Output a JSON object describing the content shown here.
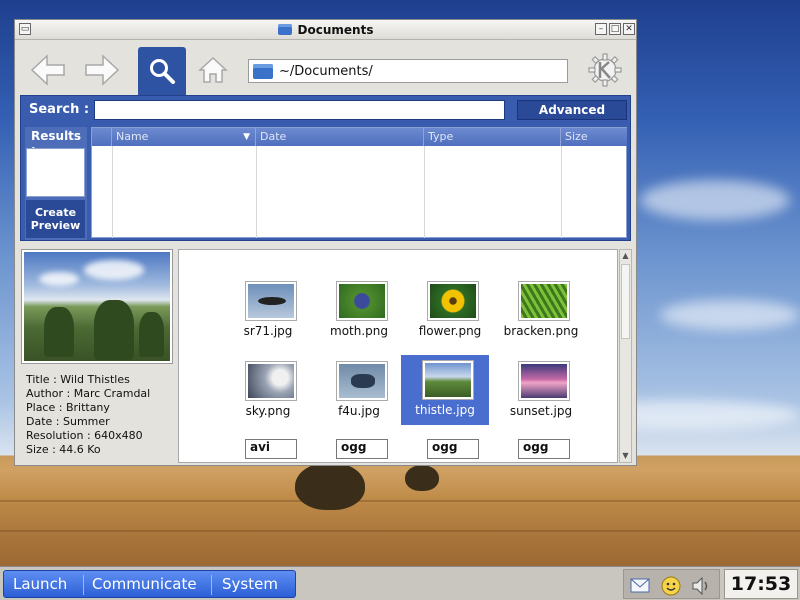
{
  "window": {
    "title": "Documents",
    "path": "~/Documents/"
  },
  "search": {
    "label": "Search :",
    "value": "",
    "advanced_label": "Advanced",
    "results_label": "Results :",
    "create_preview_label": "Create Preview",
    "columns": [
      "Name",
      "Date",
      "Type",
      "Size"
    ]
  },
  "preview": {
    "metadata": [
      "Title : Wild Thistles",
      "Author : Marc Cramdal",
      "Place : Brittany",
      "Date : Summer",
      "Resolution : 640x480",
      "Size : 44.6 Ko"
    ]
  },
  "files": [
    {
      "name": "sr71.jpg",
      "thumb": "jet-photo",
      "selected": false
    },
    {
      "name": "moth.png",
      "thumb": "moth-photo",
      "selected": false
    },
    {
      "name": "flower.png",
      "thumb": "flower-photo",
      "selected": false
    },
    {
      "name": "bracken.png",
      "thumb": "fern-photo",
      "selected": false
    },
    {
      "name": "sky.png",
      "thumb": "sky-photo",
      "selected": false
    },
    {
      "name": "f4u.jpg",
      "thumb": "plane-photo",
      "selected": false
    },
    {
      "name": "thistle.jpg",
      "thumb": "thistle-photo",
      "selected": true
    },
    {
      "name": "sunset.jpg",
      "thumb": "sunset-photo",
      "selected": false
    }
  ],
  "media_files": [
    "avi",
    "ogg",
    "ogg",
    "ogg"
  ],
  "taskbar": {
    "menus": [
      "Launch",
      "Communicate",
      "System"
    ],
    "tray_icons": [
      "mail-icon",
      "chat-smiley-icon",
      "volume-icon"
    ],
    "clock": "17:53"
  },
  "colors": {
    "accent": "#3a5cae",
    "selection": "#4a6ed0",
    "taskbar_blue": "#2c5fd6"
  }
}
